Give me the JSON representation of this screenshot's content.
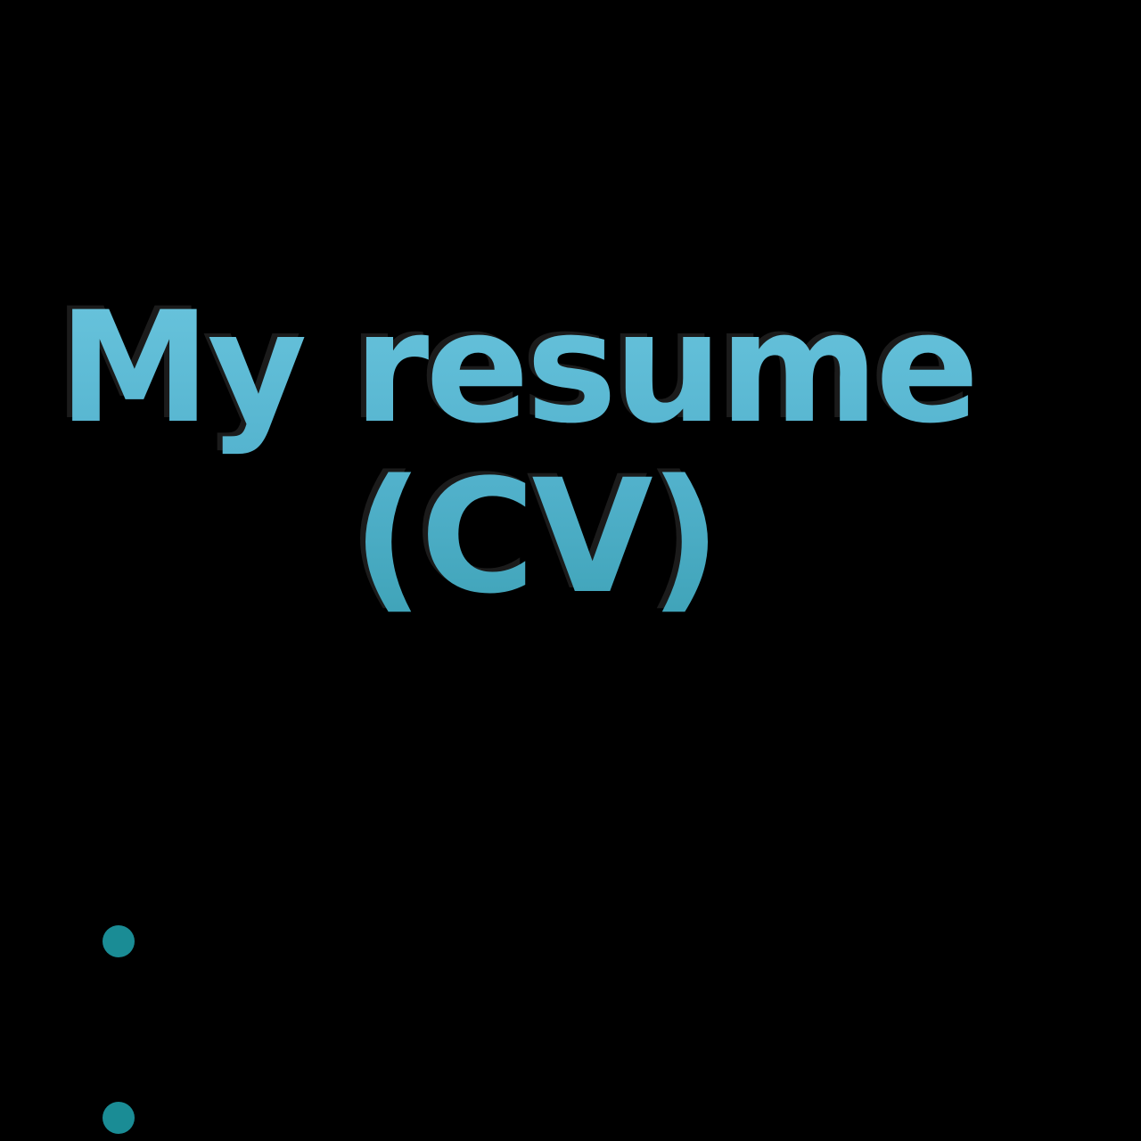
{
  "title": {
    "line1": "My resume",
    "line2": "(CV)"
  },
  "colors": {
    "background": "#000000",
    "title_text": "#5ab8d4",
    "bullet": "#1a8c95"
  },
  "bullets": {
    "count": 2
  }
}
